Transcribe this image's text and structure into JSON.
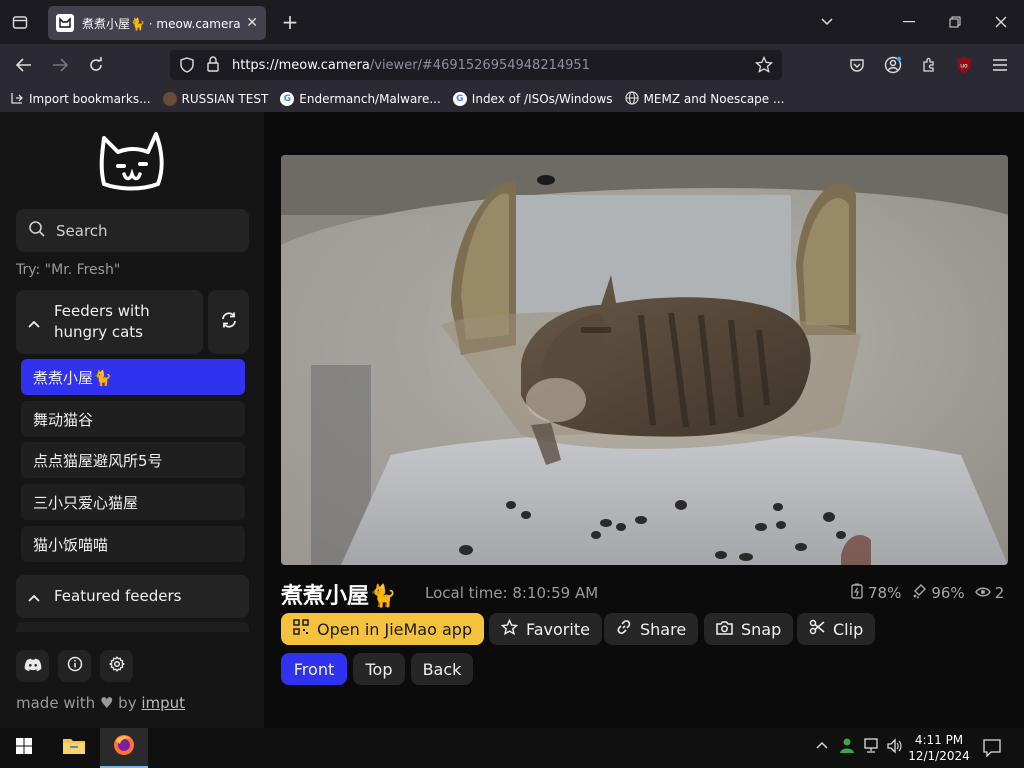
{
  "browser": {
    "tab_title": "煮煮小屋🐈 · meow.camera",
    "tab_close": "✕",
    "new_tab": "+",
    "url_domain": "https://meow.camera",
    "url_path": "/viewer/#4691526954948214951",
    "bookmarks": [
      {
        "label": "Import bookmarks..."
      },
      {
        "label": "RUSSIAN TEST"
      },
      {
        "label": "Endermanch/Malware..."
      },
      {
        "label": "Index of /ISOs/Windows"
      },
      {
        "label": "MEMZ and Noescape ..."
      }
    ]
  },
  "sidebar": {
    "search_placeholder": "Search",
    "try_hint": "Try: \"Mr. Fresh\"",
    "group_hungry": "Feeders with hungry cats",
    "feeders": [
      {
        "label": "煮煮小屋🐈"
      },
      {
        "label": "舞动猫谷"
      },
      {
        "label": "点点猫屋避风所5号"
      },
      {
        "label": "三小只爱心猫屋"
      },
      {
        "label": "猫小饭喵喵"
      }
    ],
    "group_featured": "Featured feeders",
    "made_with": "made with",
    "by": "by",
    "author": "imput"
  },
  "main": {
    "camera_title": "煮煮小屋🐈",
    "local_time": "Local time: 8:10:59 AM",
    "battery": "78%",
    "food": "96%",
    "viewers": "2",
    "actions": {
      "open_app": "Open in JieMao app",
      "favorite": "Favorite",
      "share": "Share",
      "snap": "Snap",
      "clip": "Clip"
    },
    "views": [
      "Front",
      "Top",
      "Back"
    ]
  },
  "taskbar": {
    "time": "4:11 PM",
    "date": "12/1/2024"
  },
  "colors": {
    "accent": "#3131f0",
    "yellow": "#f5c23e"
  }
}
